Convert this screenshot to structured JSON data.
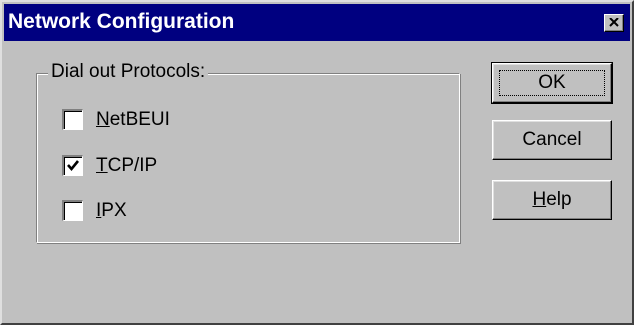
{
  "window": {
    "title": "Network Configuration"
  },
  "icons": {
    "close": "close-icon",
    "check": "check-icon"
  },
  "colors": {
    "titlebar": "#000080",
    "face": "#c0c0c0"
  },
  "group": {
    "label": "Dial out Protocols:",
    "items": [
      {
        "mnemonic": "N",
        "rest": "etBEUI",
        "checked": false
      },
      {
        "mnemonic": "T",
        "rest": "CP/IP",
        "checked": true
      },
      {
        "mnemonic": "I",
        "rest": "PX",
        "checked": false
      }
    ]
  },
  "buttons": {
    "ok": {
      "label": "OK"
    },
    "cancel": {
      "label": "Cancel"
    },
    "help": {
      "mnemonic": "H",
      "rest": "elp"
    }
  }
}
